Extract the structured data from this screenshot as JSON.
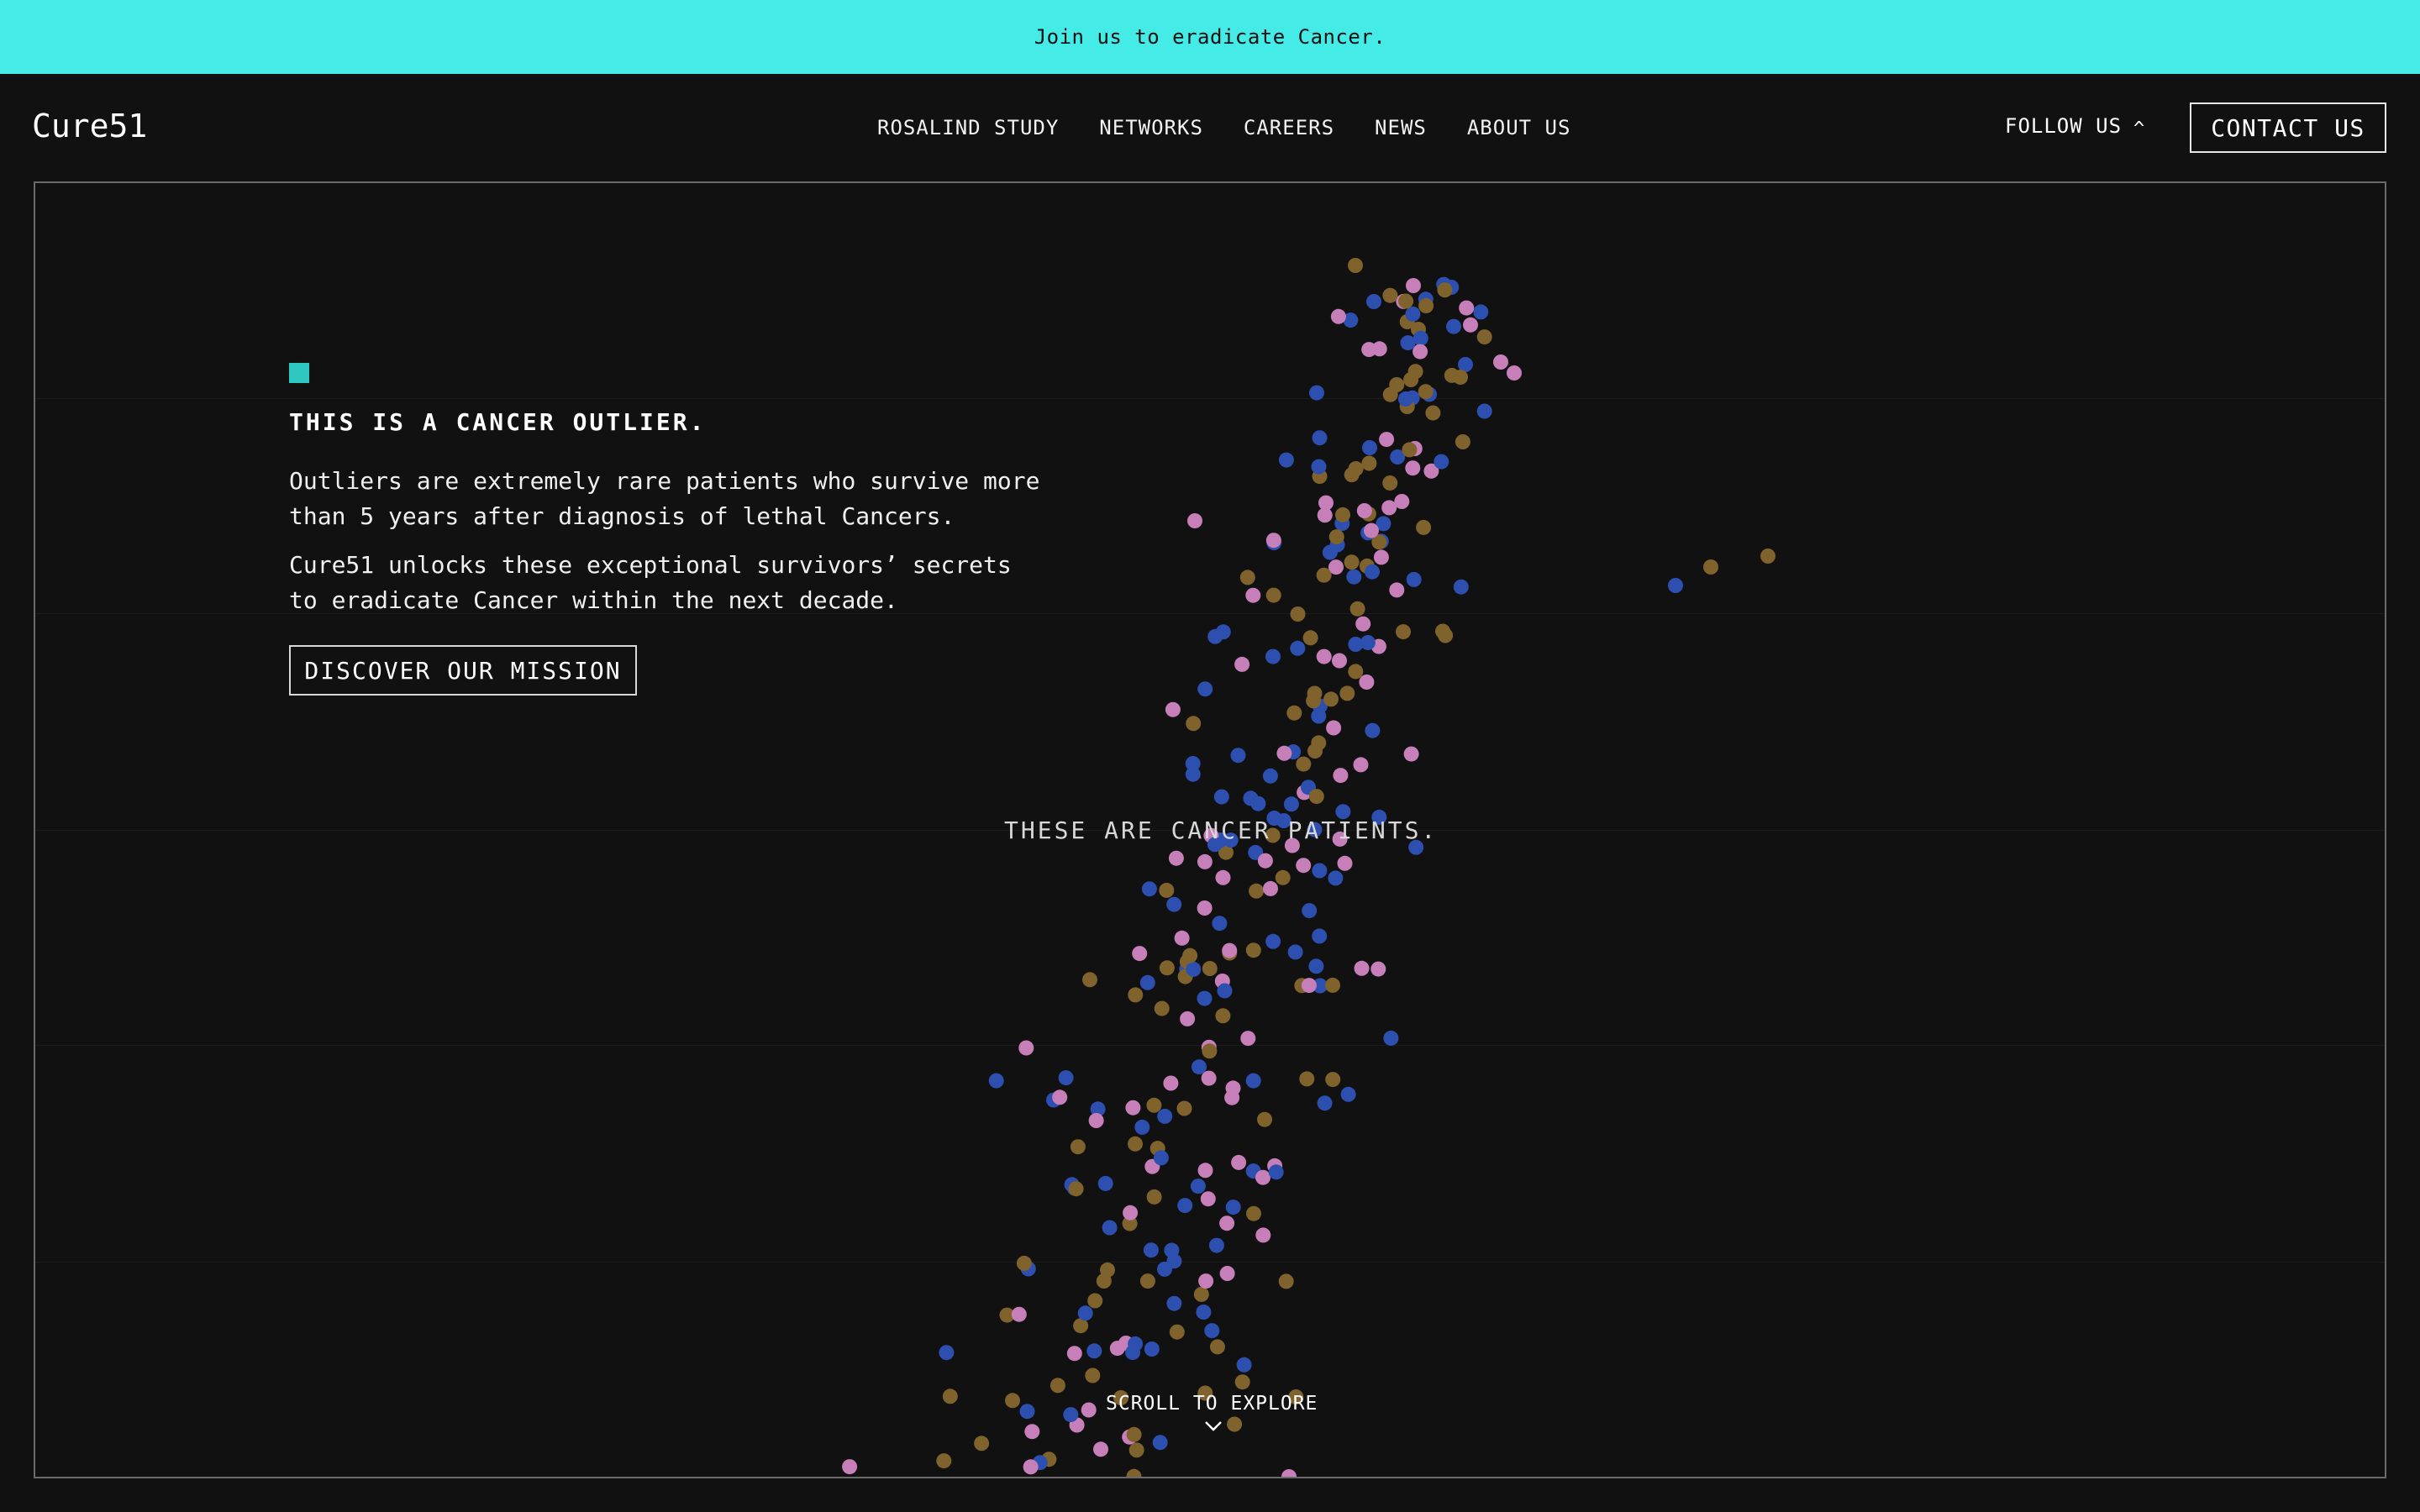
{
  "banner": {
    "text": "Join us to eradicate Cancer."
  },
  "header": {
    "logo": "Cure51",
    "nav": [
      "ROSALIND STUDY",
      "NETWORKS",
      "CAREERS",
      "NEWS",
      "ABOUT US"
    ],
    "follow_label": "FOLLOW US",
    "follow_caret": "^",
    "contact_label": "CONTACT US"
  },
  "hero": {
    "outlier_title": "THIS IS A CANCER OUTLIER.",
    "paragraph_1": "Outliers are extremely rare patients who survive more than 5 years after diagnosis of lethal Cancers.",
    "paragraph_2": "Cure51 unlocks these exceptional survivors’ secrets to eradicate Cancer within the next decade.",
    "mission_button": "DISCOVER OUR MISSION",
    "patients_label": "THESE ARE CANCER PATIENTS.",
    "scroll_label": "SCROLL TO EXPLORE"
  },
  "colors": {
    "banner": "#45ebe6",
    "background": "#111111",
    "accent_square": "#2ec7c2",
    "dot_blue": "#2d4fb0",
    "dot_pink": "#c77fba",
    "dot_gold": "#80622c"
  },
  "icons": {
    "follow": "caret-up-icon",
    "scroll": "chevron-down-icon"
  }
}
